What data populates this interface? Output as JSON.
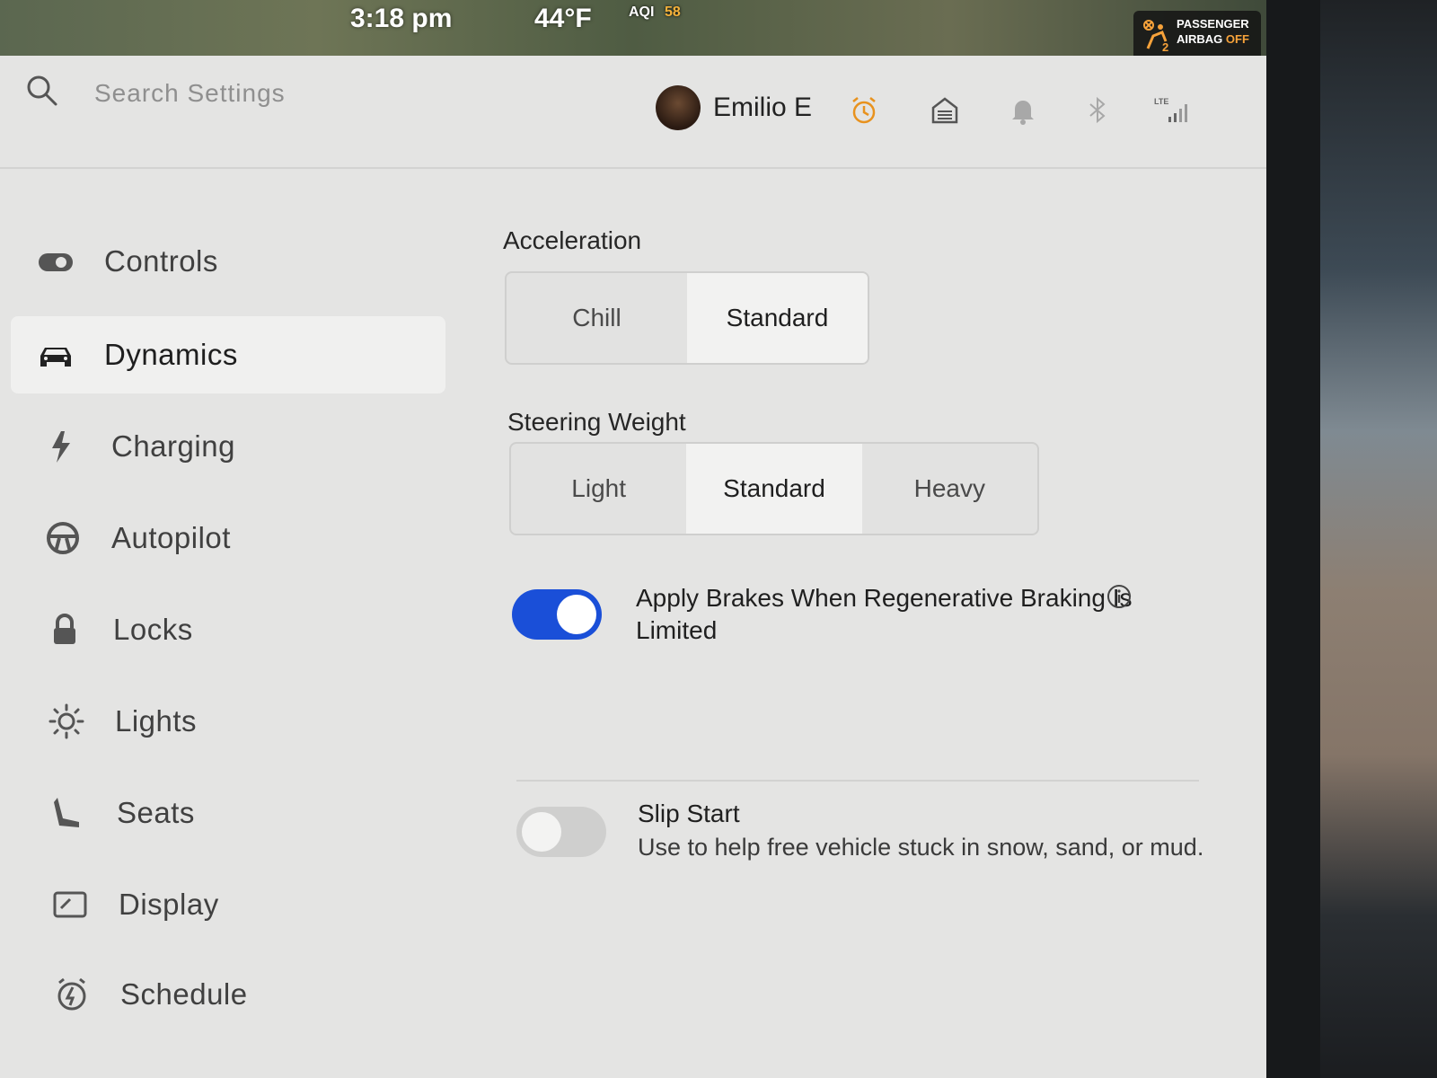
{
  "status_bar": {
    "time": "3:18 pm",
    "temperature": "44°F",
    "aqi_label": "AQI",
    "aqi_value": "58",
    "airbag_line1": "PASSENGER",
    "airbag_line2_a": "AIRBAG",
    "airbag_line2_b": "OFF"
  },
  "header": {
    "search_placeholder": "Search Settings",
    "profile_name": "Emilio E",
    "icons": [
      "alarm-clock-icon",
      "garage-icon",
      "bell-icon",
      "bluetooth-icon",
      "lte-signal-icon"
    ],
    "lte_label": "LTE"
  },
  "sidebar": {
    "items": [
      {
        "label": "Controls",
        "icon": "toggle-icon"
      },
      {
        "label": "Dynamics",
        "icon": "car-icon",
        "active": true
      },
      {
        "label": "Charging",
        "icon": "lightning-icon"
      },
      {
        "label": "Autopilot",
        "icon": "steering-wheel-icon"
      },
      {
        "label": "Locks",
        "icon": "lock-icon"
      },
      {
        "label": "Lights",
        "icon": "sun-icon"
      },
      {
        "label": "Seats",
        "icon": "seat-icon"
      },
      {
        "label": "Display",
        "icon": "display-icon"
      },
      {
        "label": "Schedule",
        "icon": "schedule-icon"
      }
    ]
  },
  "main": {
    "acceleration": {
      "title": "Acceleration",
      "options": [
        "Chill",
        "Standard"
      ],
      "selected": "Standard"
    },
    "steering_weight": {
      "title": "Steering Weight",
      "options": [
        "Light",
        "Standard",
        "Heavy"
      ],
      "selected": "Standard"
    },
    "apply_brakes": {
      "title_line1": "Apply Brakes When Regenerative Braking Is",
      "title_line2": "Limited",
      "enabled": true
    },
    "slip_start": {
      "title": "Slip Start",
      "description": "Use to help free vehicle stuck in snow, sand, or mud.",
      "enabled": false
    }
  },
  "colors": {
    "toggle_on": "#1a4fd8",
    "alarm_accent": "#e8921e",
    "background": "#e4e4e3"
  }
}
